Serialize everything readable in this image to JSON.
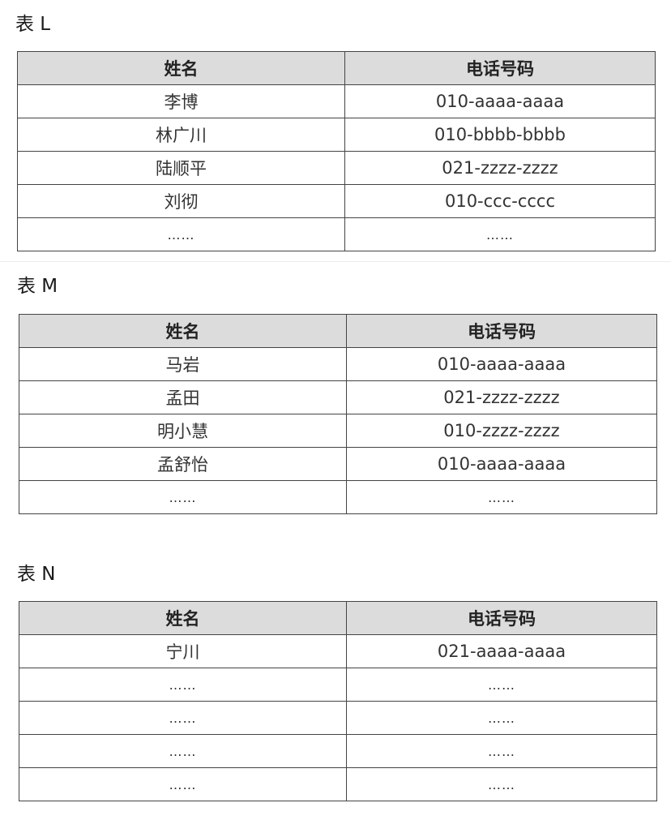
{
  "tables": [
    {
      "title": "表 L",
      "headers": [
        "姓名",
        "电话号码"
      ],
      "rows": [
        [
          "李博",
          "010-aaaa-aaaa"
        ],
        [
          "林广川",
          "010-bbbb-bbbb"
        ],
        [
          "陆顺平",
          "021-zzzz-zzzz"
        ],
        [
          "刘彻",
          "010-ccc-cccc"
        ],
        [
          "……",
          "……"
        ]
      ]
    },
    {
      "title": "表 M",
      "headers": [
        "姓名",
        "电话号码"
      ],
      "rows": [
        [
          "马岩",
          "010-aaaa-aaaa"
        ],
        [
          "孟田",
          "021-zzzz-zzzz"
        ],
        [
          "明小慧",
          "010-zzzz-zzzz"
        ],
        [
          "孟舒怡",
          "010-aaaa-aaaa"
        ],
        [
          "……",
          "……"
        ]
      ]
    },
    {
      "title": "表 N",
      "headers": [
        "姓名",
        "电话号码"
      ],
      "rows": [
        [
          "宁川",
          "021-aaaa-aaaa"
        ],
        [
          "……",
          "……"
        ],
        [
          "……",
          "……"
        ],
        [
          "……",
          "……"
        ],
        [
          "……",
          "……"
        ]
      ]
    }
  ]
}
